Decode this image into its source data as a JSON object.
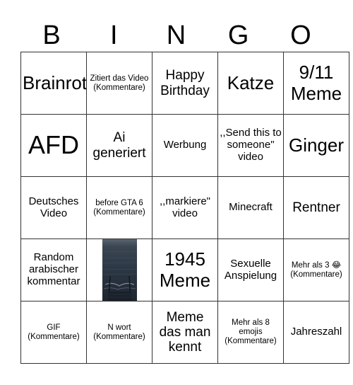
{
  "header": {
    "letters": [
      "B",
      "I",
      "N",
      "G",
      "O"
    ]
  },
  "grid": {
    "rows": [
      [
        {
          "text": "Brainrot",
          "size": "lg"
        },
        {
          "text": "Zitiert das Video (Kommentare)",
          "size": "xs"
        },
        {
          "text": "Happy Birthday",
          "size": "md"
        },
        {
          "text": "Katze",
          "size": "lg"
        },
        {
          "text": "9/11 Meme",
          "size": "lg"
        }
      ],
      [
        {
          "text": "AFD",
          "size": "xl"
        },
        {
          "text": "Ai generiert",
          "size": "md"
        },
        {
          "text": "Werbung",
          "size": "sm"
        },
        {
          "text": ",,Send this to someone\" video",
          "size": "sm"
        },
        {
          "text": "Ginger",
          "size": "lg"
        }
      ],
      [
        {
          "text": "Deutsches Video",
          "size": "sm"
        },
        {
          "text": "before GTA 6 (Kommentare)",
          "size": "xs"
        },
        {
          "text": ",,markiere\" video",
          "size": "sm"
        },
        {
          "text": "Minecraft",
          "size": "sm"
        },
        {
          "text": "Rentner",
          "size": "md"
        }
      ],
      [
        {
          "text": "Random arabischer kommentar",
          "size": "sm"
        },
        {
          "image": "stormy-sea-stairs-image"
        },
        {
          "text": "1945 Meme",
          "size": "lg"
        },
        {
          "text": "Sexuelle Anspielung",
          "size": "sm"
        },
        {
          "text": "Mehr als 3 😂 (Kommentare)",
          "size": "xs"
        }
      ],
      [
        {
          "text": "GIF (Kommentare)",
          "size": "xs"
        },
        {
          "text": "N wort (Kommentare)",
          "size": "xs"
        },
        {
          "text": "Meme das man kennt",
          "size": "md"
        },
        {
          "text": "Mehr als 8 emojis (Kommentare)",
          "size": "xs"
        },
        {
          "text": "Jahreszahl",
          "size": "sm"
        }
      ]
    ]
  }
}
